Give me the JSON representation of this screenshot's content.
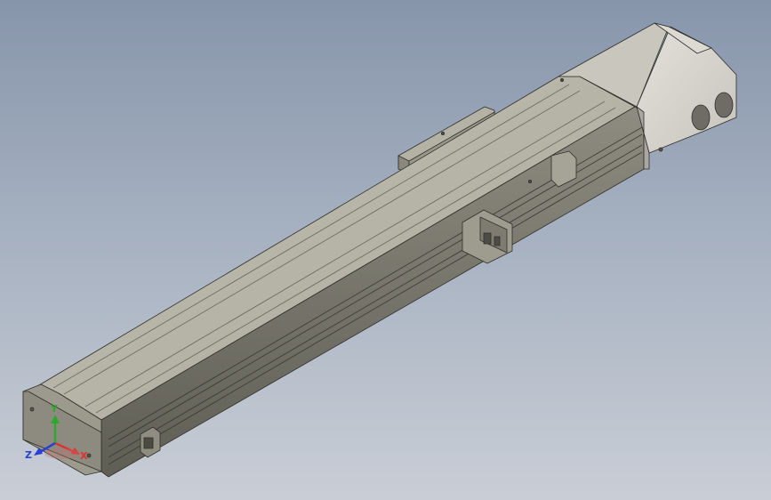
{
  "viewport": {
    "background_top": "#8795ab",
    "background_bottom": "#c9ced6"
  },
  "model": {
    "body_color": "#a8a697",
    "top_color": "#b9b7a8",
    "side_color": "#7f7d70",
    "motor_color": "#d5d3cc",
    "edge_color": "#2f2f2a"
  },
  "triad": {
    "x_label": "X",
    "y_label": "Y",
    "z_label": "Z",
    "x_color": "#e03030",
    "y_color": "#2ea82e",
    "z_color": "#2a3fd6"
  }
}
